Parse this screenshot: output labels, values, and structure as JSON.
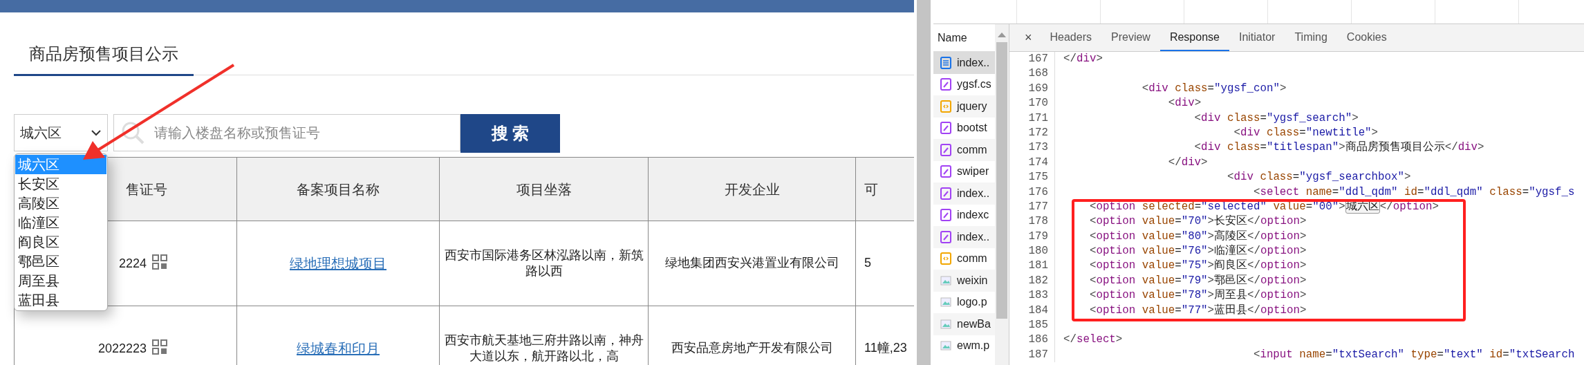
{
  "page": {
    "title": "商品房预售项目公示",
    "district_select": {
      "value": "城六区",
      "expanded": true,
      "options": [
        {
          "label": "城六区",
          "selected": true
        },
        {
          "label": "长安区",
          "selected": false
        },
        {
          "label": "高陵区",
          "selected": false
        },
        {
          "label": "临潼区",
          "selected": false
        },
        {
          "label": "阎良区",
          "selected": false
        },
        {
          "label": "鄠邑区",
          "selected": false
        },
        {
          "label": "周至县",
          "selected": false
        },
        {
          "label": "蓝田县",
          "selected": false
        }
      ]
    },
    "search": {
      "placeholder": "请输入楼盘名称或预售证号"
    },
    "search_button": "搜 索",
    "pointer_arrow": true,
    "table": {
      "columns": [
        "售证号",
        "备案项目名称",
        "项目坐落",
        "开发企业",
        "可"
      ],
      "rows": [
        {
          "certificate": "2224",
          "project": "绿地理想城项目",
          "location": "西安市国际港务区林泓路以南，新筑路以西",
          "developer": "绿地集团西安兴港置业有限公司",
          "column_5": "5"
        },
        {
          "certificate": "2022223",
          "project": "绿城春和印月",
          "location": "西安市航天基地三府井路以南，神舟大道以东，航开路以北，高",
          "developer": "西安品意房地产开发有限公司",
          "column_5": "11幢,23"
        }
      ]
    }
  },
  "devtools": {
    "request_list": {
      "header": "Name",
      "items": [
        {
          "name": "index..",
          "kind": "document",
          "selected": true
        },
        {
          "name": "ygsf.cs",
          "kind": "stylesheet",
          "selected": false
        },
        {
          "name": "jquery",
          "kind": "script",
          "selected": false
        },
        {
          "name": "bootst",
          "kind": "stylesheet",
          "selected": false
        },
        {
          "name": "comm",
          "kind": "stylesheet",
          "selected": false
        },
        {
          "name": "swiper",
          "kind": "stylesheet",
          "selected": false
        },
        {
          "name": "index..",
          "kind": "stylesheet",
          "selected": false
        },
        {
          "name": "indexc",
          "kind": "stylesheet",
          "selected": false
        },
        {
          "name": "index..",
          "kind": "stylesheet",
          "selected": false
        },
        {
          "name": "comm",
          "kind": "script",
          "selected": false
        },
        {
          "name": "weixin",
          "kind": "image",
          "selected": false
        },
        {
          "name": "logo.p",
          "kind": "image",
          "selected": false
        },
        {
          "name": "newBa",
          "kind": "image",
          "selected": false
        },
        {
          "name": "ewm.p",
          "kind": "image",
          "selected": false
        }
      ]
    },
    "close": "×",
    "tabs": [
      {
        "label": "Headers",
        "selected": false
      },
      {
        "label": "Preview",
        "selected": false
      },
      {
        "label": "Response",
        "selected": true
      },
      {
        "label": "Initiator",
        "selected": false
      },
      {
        "label": "Timing",
        "selected": false
      },
      {
        "label": "Cookies",
        "selected": false
      }
    ],
    "code_blocks": [
      {
        "kind": "plain",
        "lines": [
          {
            "num": "167",
            "code": "</div>"
          },
          {
            "num": "168"
          },
          {
            "num": "169",
            "code": "            <div class=\"ygsf_con\">"
          },
          {
            "num": "170",
            "code": "                <div>"
          },
          {
            "num": "171",
            "code": "                    <div class=\"ygsf_search\">"
          },
          {
            "num": "172",
            "code": "                          <div class=\"newtitle\">"
          },
          {
            "num": "173",
            "code": "                    <div class=\"titlespan\">商品房预售项目公示</div>"
          },
          {
            "num": "174",
            "code": "                </div>"
          },
          {
            "num": "175",
            "code": "                         <div class=\"ygsf_searchbox\">"
          },
          {
            "num": "176",
            "code": "                             <select name=\"ddl_qdm\" id=\"ddl_qdm\" class=\"ygsf_s"
          }
        ]
      },
      {
        "kind": "boxed",
        "lines": [
          {
            "num": "177",
            "code": "    <option selected=\"selected\" value=\"00\">",
            "match": "城六区",
            "code_after": "</option>"
          },
          {
            "num": "178",
            "code": "    <option value=\"70\">长安区</option>"
          },
          {
            "num": "179",
            "code": "    <option value=\"80\">高陵区</option>"
          },
          {
            "num": "180",
            "code": "    <option value=\"76\">临潼区</option>"
          },
          {
            "num": "181",
            "code": "    <option value=\"75\">阎良区</option>"
          },
          {
            "num": "182",
            "code": "    <option value=\"79\">鄠邑区</option>"
          },
          {
            "num": "183",
            "code": "    <option value=\"78\">周至县</option>"
          },
          {
            "num": "184",
            "code": "    <option value=\"77\">蓝田县</option>"
          }
        ]
      },
      {
        "kind": "plain",
        "lines": [
          {
            "num": "185"
          },
          {
            "num": "186",
            "code": "</select>"
          },
          {
            "num": "187",
            "code": "                             <input name=\"txtSearch\" type=\"text\" id=\"txtSearch"
          }
        ]
      }
    ]
  }
}
